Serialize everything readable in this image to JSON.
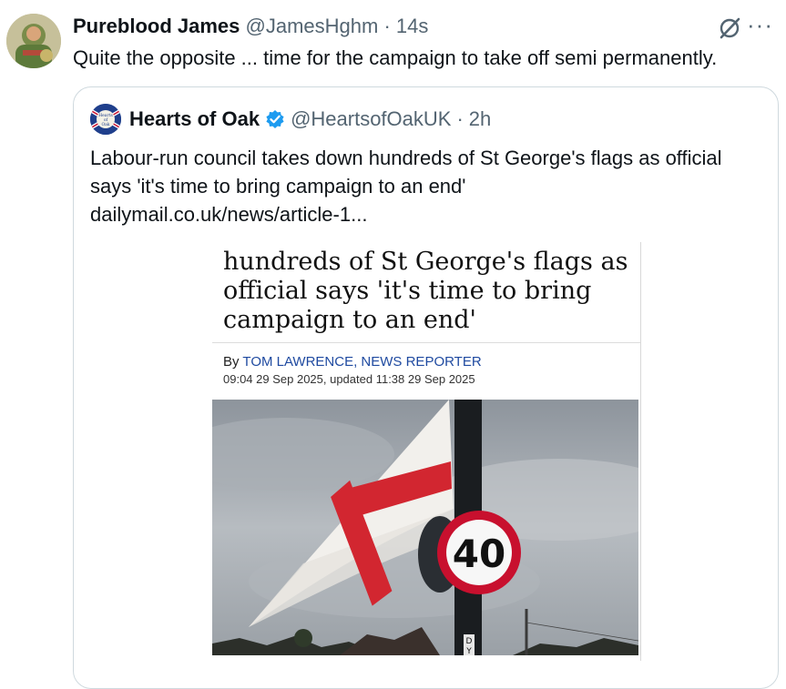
{
  "tweet": {
    "author_name": "Pureblood James",
    "author_handle": "@JamesHghm",
    "separator": "·",
    "time": "14s",
    "text": "Quite the opposite ... time for the campaign to take off semi permanently.",
    "more_icon": "more-horizontal-icon",
    "grok_icon": "grok-icon"
  },
  "quoted": {
    "author_name": "Hearts of Oak",
    "author_handle": "@HeartsofOakUK",
    "separator": "·",
    "time": "2h",
    "verified": true,
    "verified_color": "#1d9bf0",
    "text_lines": [
      "Labour-run council takes down hundreds of St George's flags as official",
      "says 'it's time to bring campaign to an end'",
      "dailymail.co.uk/news/article-1..."
    ],
    "avatar_label": [
      "Hearts",
      "of",
      "Oak"
    ]
  },
  "article": {
    "headline_lines": [
      "hundreds of St George's flags as",
      "official says 'it's time to bring",
      "campaign to an end'"
    ],
    "byline_prefix": "By",
    "byline_author": "TOM LAWRENCE, NEWS REPORTER",
    "dateline": "09:04 29 Sep 2025, updated 11:38 29 Sep 2025",
    "sign_speed": "40",
    "pole_text": "D",
    "pole_text_2": "Y"
  },
  "colors": {
    "text_primary": "#0f1419",
    "text_secondary": "#536471",
    "link_blue": "#1f4aa0",
    "flag_red": "#d22630",
    "sign_red": "#c8102e"
  }
}
